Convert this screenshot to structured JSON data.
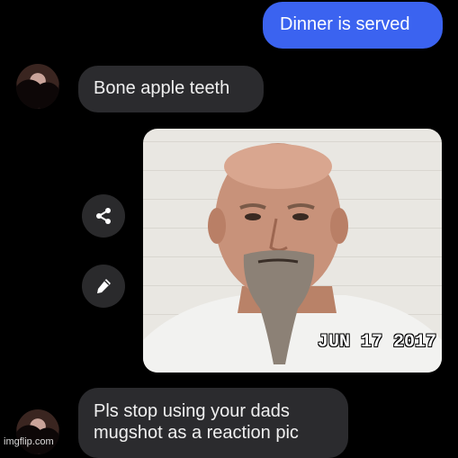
{
  "messages": {
    "sent_1": "Dinner is served",
    "received_1": "Bone apple teeth",
    "received_2_line1": "Pls stop using your dads",
    "received_2_line2": "mugshot as a reaction pic"
  },
  "photo": {
    "stamp": "JUN 17 2017"
  },
  "icons": {
    "share": "share-icon",
    "edit": "pencil-icon"
  },
  "watermark": "imgflip.com",
  "colors": {
    "background": "#000000",
    "sent_bubble": "#3b63f0",
    "received_bubble": "#2b2b2e",
    "action_button": "#2a2a2c"
  }
}
